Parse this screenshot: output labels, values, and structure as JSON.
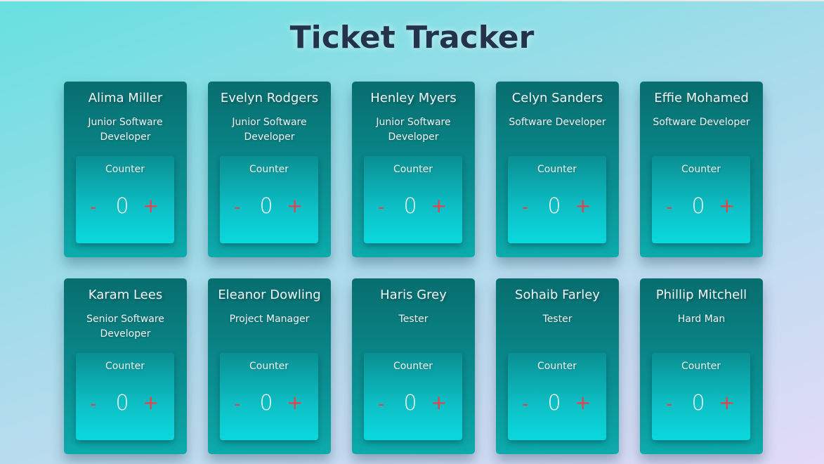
{
  "title": "Ticket Tracker",
  "counter_label": "Counter",
  "decrement_label": "-",
  "increment_label": "+",
  "colors": {
    "title": "#22334a",
    "card_top": "#086d6f",
    "counter_bottom": "#0ad8de",
    "button": "#ee3f46"
  },
  "people": [
    {
      "name": "Alima Miller",
      "role": "Junior Software Developer",
      "count": "0"
    },
    {
      "name": "Evelyn Rodgers",
      "role": "Junior Software Developer",
      "count": "0"
    },
    {
      "name": "Henley Myers",
      "role": "Junior Software Developer",
      "count": "0"
    },
    {
      "name": "Celyn Sanders",
      "role": "Software Developer",
      "count": "0"
    },
    {
      "name": "Effie Mohamed",
      "role": "Software Developer",
      "count": "0"
    },
    {
      "name": "Karam Lees",
      "role": "Senior Software Developer",
      "count": "0"
    },
    {
      "name": "Eleanor Dowling",
      "role": "Project Manager",
      "count": "0"
    },
    {
      "name": "Haris Grey",
      "role": "Tester",
      "count": "0"
    },
    {
      "name": "Sohaib Farley",
      "role": "Tester",
      "count": "0"
    },
    {
      "name": "Phillip Mitchell",
      "role": "Hard Man",
      "count": "0"
    }
  ]
}
